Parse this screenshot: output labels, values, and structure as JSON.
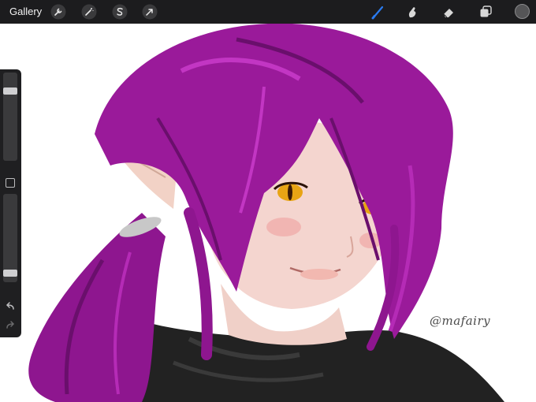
{
  "topbar": {
    "gallery_label": "Gallery",
    "left_tools": [
      {
        "icon": "wrench-icon",
        "name": "actions-button"
      },
      {
        "icon": "magic-wand-icon",
        "name": "adjustments-button"
      },
      {
        "icon": "selection-s-icon",
        "name": "selection-button"
      },
      {
        "icon": "arrow-cursor-icon",
        "name": "transform-button"
      }
    ],
    "right_tools": [
      {
        "icon": "brush-icon",
        "name": "brush-tool-button",
        "active": true
      },
      {
        "icon": "smudge-finger-icon",
        "name": "smudge-tool-button"
      },
      {
        "icon": "eraser-icon",
        "name": "eraser-tool-button"
      },
      {
        "icon": "layers-icon",
        "name": "layers-button"
      }
    ],
    "active_color": "#555557",
    "active_tool_color": "#2a7bf0"
  },
  "sidebar": {
    "size_slider_level": 0.82,
    "opacity_slider_level": 0.07,
    "undo_icon": "undo-arrow-icon",
    "redo_icon": "redo-arrow-icon"
  },
  "canvas": {
    "signature_text": "@mafairy",
    "palette": {
      "hair": "#9a1a9a",
      "hair_dark": "#6a0f6c",
      "skin": "#f4d5cf",
      "eye": "#e8a414",
      "sweater": "#222222",
      "hair_tie": "#c8c8c8"
    }
  }
}
